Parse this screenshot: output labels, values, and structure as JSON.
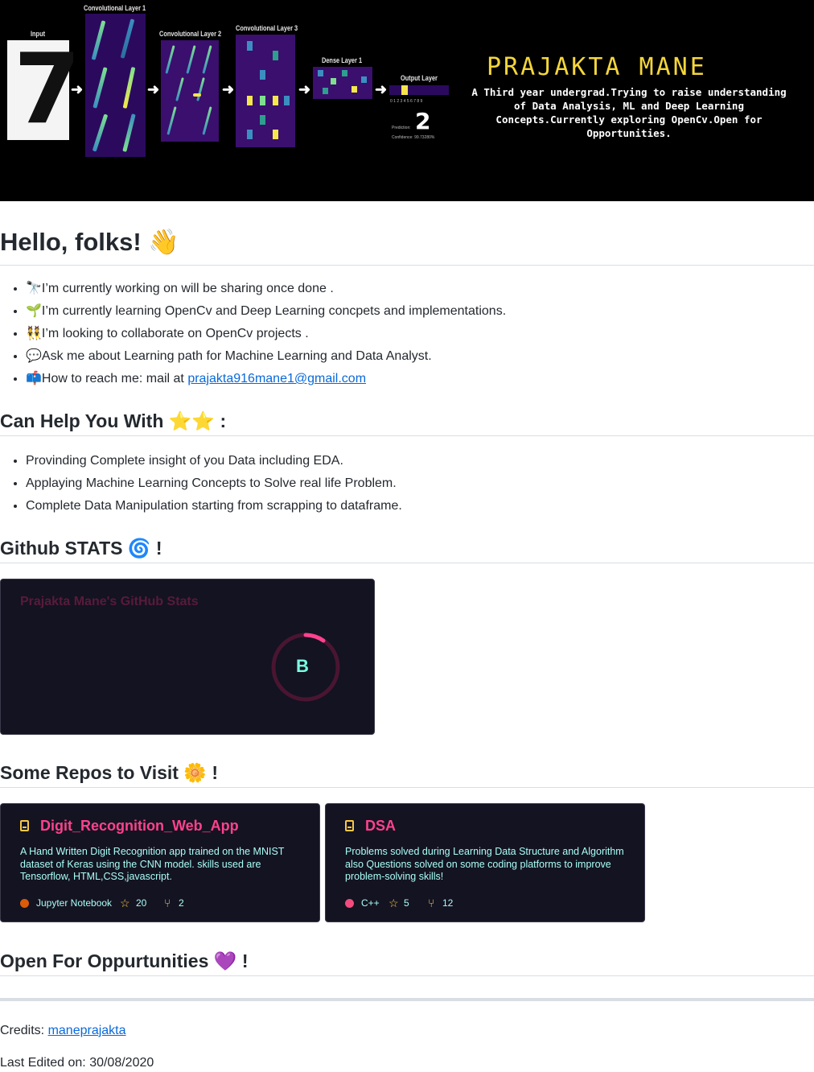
{
  "banner": {
    "layer_labels": {
      "input": "Input",
      "conv1": "Convolutional Layer 1",
      "conv2": "Convolutional Layer 2",
      "conv3": "Convolutional Layer 3",
      "dense1": "Dense Layer 1",
      "output": "Output Layer"
    },
    "input_digit": "7",
    "output_digit": "2",
    "output_scale": "0 1 2 3 4 5 6 7 8 9",
    "prediction_label": "Prediction:",
    "confidence_label": "Confidence: 99.73280%",
    "name": "PRAJAKTA MANE",
    "description": "A Third year undergrad.Trying to raise understanding of Data Analysis, ML and Deep Learning Concepts.Currently exploring OpenCv.Open for Opportunities."
  },
  "heading_hello": "Hello, folks!",
  "heading_hello_emoji": "👋",
  "intro_items": [
    {
      "emoji": "🔭",
      "text": "I’m currently working on will be sharing once done ."
    },
    {
      "emoji": "🌱",
      "text": "I’m currently learning OpenCv and Deep Learning concpets and implementations."
    },
    {
      "emoji": "👯",
      "text": "I’m looking to collaborate on OpenCv projects ."
    },
    {
      "emoji": "💬",
      "text": "Ask me about Learning path for Machine Learning and Data Analyst."
    },
    {
      "emoji": "📫",
      "text": "How to reach me: mail at ",
      "link": "prajakta916mane1@gmail.com"
    }
  ],
  "heading_help": "Can Help You With",
  "heading_help_emoji": "⭐⭐",
  "heading_help_suffix": ":",
  "help_items": [
    "Provinding Complete insight of you Data including EDA.",
    "Applaying Machine Learning Concepts to Solve real life Problem.",
    "Complete Data Manipulation starting from scrapping to dataframe."
  ],
  "heading_stats": "Github STATS",
  "heading_stats_emoji": "🌀",
  "heading_stats_suffix": "!",
  "stats_card": {
    "title": "Prajakta Mane's GitHub Stats",
    "grade": "B"
  },
  "heading_repos": "Some Repos to Visit",
  "heading_repos_emoji": "🌼",
  "heading_repos_suffix": "!",
  "repos": [
    {
      "name": "Digit_Recognition_Web_App",
      "description": "A Hand Written Digit Recognition app trained on the MNIST dataset of Keras using the CNN model. skills used are Tensorflow, HTML,CSS,javascript.",
      "language": "Jupyter Notebook",
      "language_color": "#DA5B0B",
      "stars": "20",
      "forks": "2"
    },
    {
      "name": "DSA",
      "description": "Problems solved during Learning Data Structure and Algorithm also Questions solved on some coding platforms to improve problem-solving skills!",
      "language": "C++",
      "language_color": "#f34b7d",
      "stars": "5",
      "forks": "12"
    }
  ],
  "heading_open": "Open For Oppurtunities",
  "heading_open_emoji": "💜",
  "heading_open_suffix": "!",
  "credits_label": "Credits: ",
  "credits_link": "maneprajakta",
  "last_edited": "Last Edited on: 30/08/2020"
}
